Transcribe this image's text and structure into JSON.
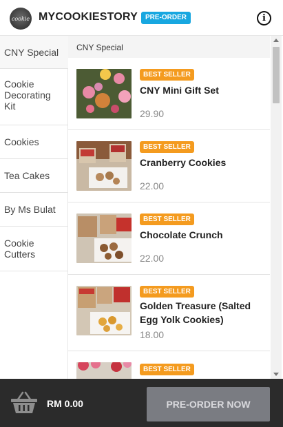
{
  "header": {
    "logo_text": "cookie",
    "brand": "MYCOOKIESTORY",
    "badge": "PRE-ORDER",
    "info_symbol": "i"
  },
  "sidebar": {
    "items": [
      {
        "label": "CNY Special",
        "active": true
      },
      {
        "label": "Cookie Decorating Kit",
        "active": false
      },
      {
        "label": "Cookies",
        "active": false
      },
      {
        "label": "Tea Cakes",
        "active": false
      },
      {
        "label": "By Ms Bulat",
        "active": false
      },
      {
        "label": "Cookie Cutters",
        "active": false
      }
    ]
  },
  "main": {
    "section_title": "CNY Special",
    "products": [
      {
        "tag": "BEST SELLER",
        "name": "CNY Mini Gift Set",
        "price": "29.90"
      },
      {
        "tag": "BEST SELLER",
        "name": "Cranberry Cookies",
        "price": "22.00"
      },
      {
        "tag": "BEST SELLER",
        "name": "Chocolate Crunch",
        "price": "22.00"
      },
      {
        "tag": "BEST SELLER",
        "name": "Golden Treasure (Salted Egg Yolk Cookies)",
        "price": "18.00"
      },
      {
        "tag": "BEST SELLER",
        "name": "",
        "price": ""
      }
    ]
  },
  "footer": {
    "total": "RM 0.00",
    "button_label": "PRE-ORDER NOW",
    "basket_icon": "basket-icon"
  },
  "colors": {
    "badge": "#18a7e0",
    "tag": "#f49b1f",
    "footer": "#2b2b2b",
    "button": "#7a7c82"
  }
}
